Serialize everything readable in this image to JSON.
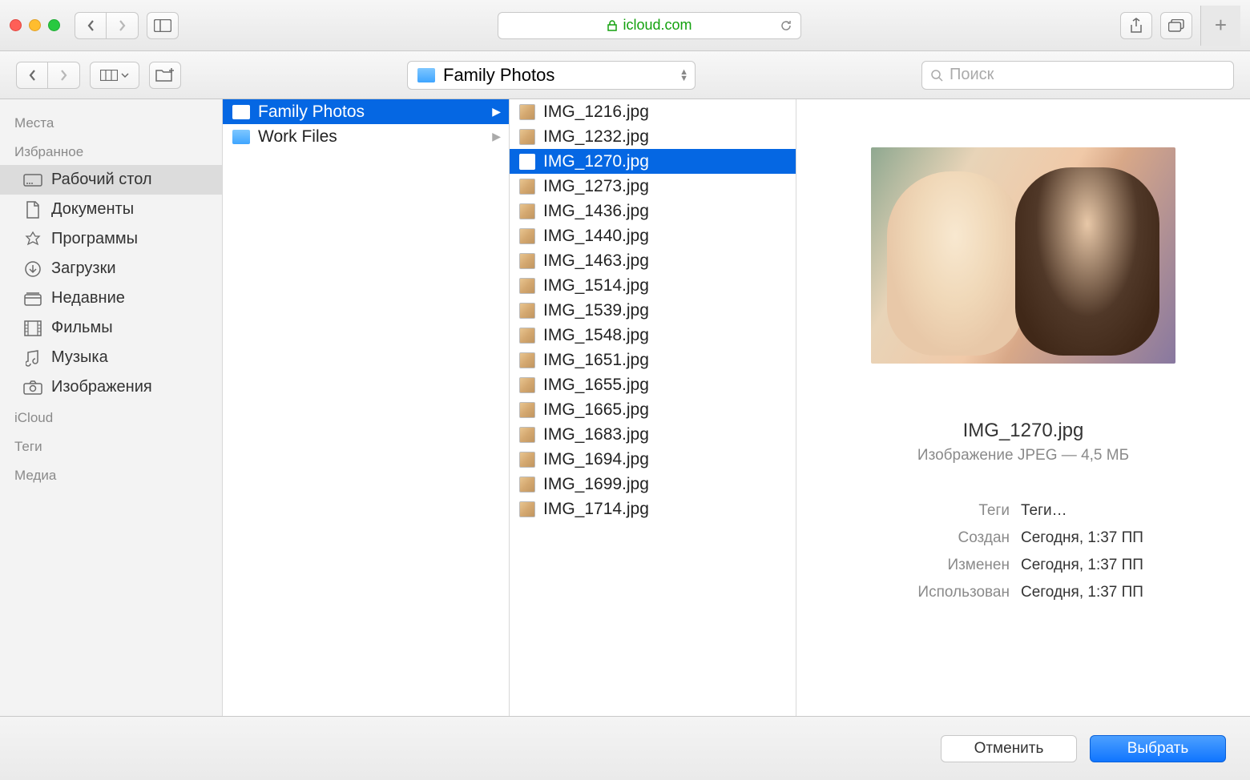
{
  "safari": {
    "url": "icloud.com"
  },
  "finder": {
    "path_label": "Family Photos",
    "search_placeholder": "Поиск"
  },
  "sidebar": {
    "places_head": "Места",
    "favorites_head": "Избранное",
    "items": [
      {
        "label": "Рабочий стол"
      },
      {
        "label": "Документы"
      },
      {
        "label": "Программы"
      },
      {
        "label": "Загрузки"
      },
      {
        "label": "Недавние"
      },
      {
        "label": "Фильмы"
      },
      {
        "label": "Музыка"
      },
      {
        "label": "Изображения"
      }
    ],
    "icloud_head": "iCloud",
    "tags_head": "Теги",
    "media_head": "Медиа"
  },
  "column1": [
    {
      "label": "Family Photos",
      "selected": true
    },
    {
      "label": "Work Files",
      "selected": false
    }
  ],
  "column2": [
    {
      "label": "IMG_1216.jpg"
    },
    {
      "label": "IMG_1232.jpg"
    },
    {
      "label": "IMG_1270.jpg",
      "selected": true
    },
    {
      "label": "IMG_1273.jpg"
    },
    {
      "label": "IMG_1436.jpg"
    },
    {
      "label": "IMG_1440.jpg"
    },
    {
      "label": "IMG_1463.jpg"
    },
    {
      "label": "IMG_1514.jpg"
    },
    {
      "label": "IMG_1539.jpg"
    },
    {
      "label": "IMG_1548.jpg"
    },
    {
      "label": "IMG_1651.jpg"
    },
    {
      "label": "IMG_1655.jpg"
    },
    {
      "label": "IMG_1665.jpg"
    },
    {
      "label": "IMG_1683.jpg"
    },
    {
      "label": "IMG_1694.jpg"
    },
    {
      "label": "IMG_1699.jpg"
    },
    {
      "label": "IMG_1714.jpg"
    }
  ],
  "preview": {
    "filename": "IMG_1270.jpg",
    "kind": "Изображение JPEG — 4,5 МБ",
    "tags_label": "Теги",
    "tags_placeholder": "Теги…",
    "created_label": "Создан",
    "created_value": "Сегодня, 1:37 ПП",
    "modified_label": "Изменен",
    "modified_value": "Сегодня, 1:37 ПП",
    "used_label": "Использован",
    "used_value": "Сегодня, 1:37 ПП"
  },
  "footer": {
    "cancel": "Отменить",
    "choose": "Выбрать"
  }
}
